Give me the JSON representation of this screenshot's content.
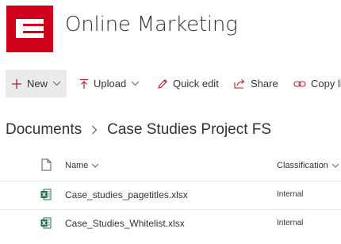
{
  "site": {
    "title": "Online Marketing"
  },
  "toolbar": {
    "new_label": "New",
    "upload_label": "Upload",
    "quick_edit_label": "Quick edit",
    "share_label": "Share",
    "copy_link_label": "Copy link"
  },
  "breadcrumb": {
    "root": "Documents",
    "current": "Case Studies Project FS"
  },
  "columns": {
    "name": "Name",
    "classification": "Classification"
  },
  "files": [
    {
      "name": "Case_studies_pagetitles.xlsx",
      "classification": "Internal"
    },
    {
      "name": "Case_Studies_Whitelist.xlsx",
      "classification": "Internal"
    }
  ],
  "colors": {
    "brand": "#d0021b",
    "accent": "#a4262c",
    "excel": "#217346"
  }
}
